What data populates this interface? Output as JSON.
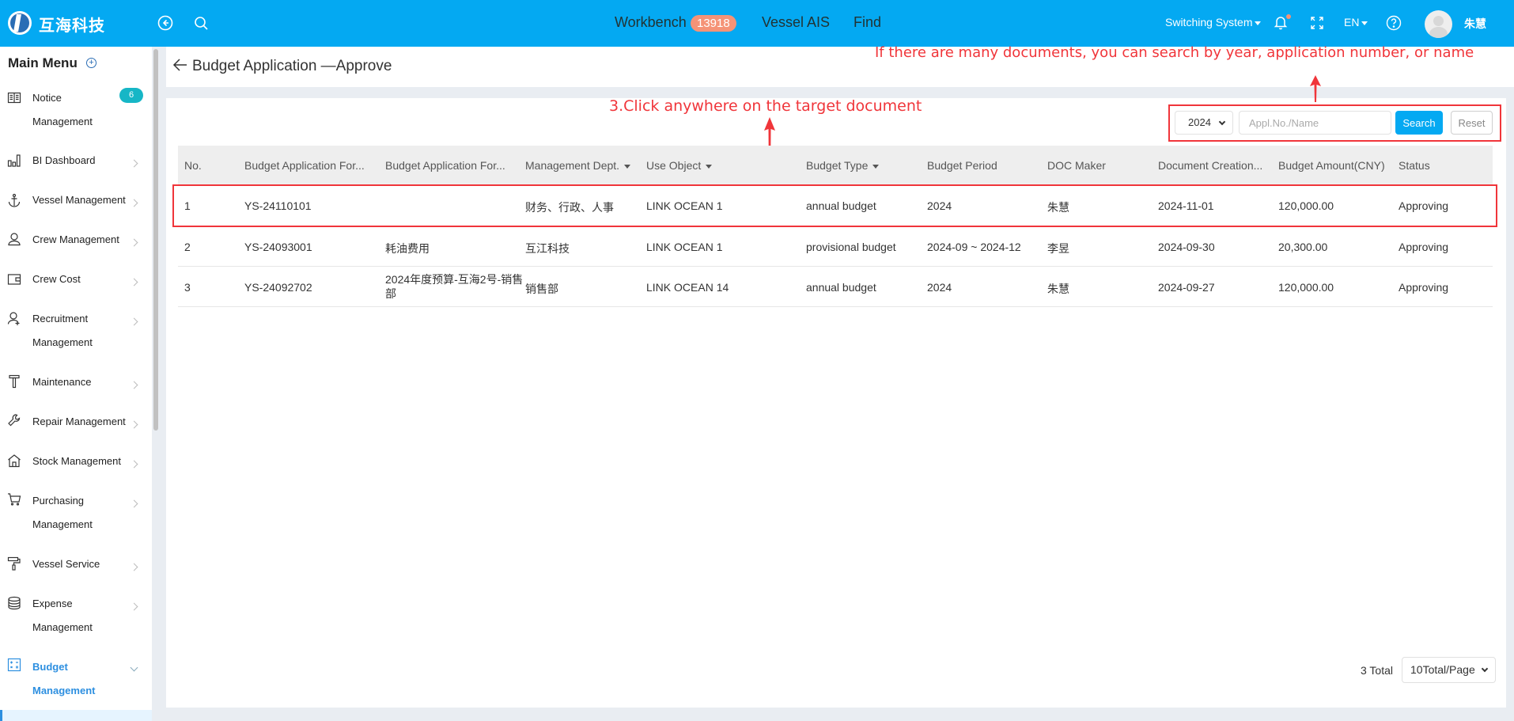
{
  "header": {
    "brand": "互海科技",
    "nav": {
      "workbench": "Workbench",
      "workbench_count": "13918",
      "vessel_ais": "Vessel AIS",
      "find": "Find"
    },
    "switching_system": "Switching System",
    "language": "EN",
    "username": "朱慧"
  },
  "sidebar": {
    "title": "Main Menu",
    "items": [
      {
        "label": "Notice Management",
        "icon": "book-icon",
        "badge": "6"
      },
      {
        "label": "BI Dashboard",
        "icon": "bar-chart-icon"
      },
      {
        "label": "Vessel Management",
        "icon": "anchor-icon"
      },
      {
        "label": "Crew Management",
        "icon": "person-icon"
      },
      {
        "label": "Crew Cost",
        "icon": "wallet-icon"
      },
      {
        "label": "Recruitment Management",
        "icon": "person-add-icon"
      },
      {
        "label": "Maintenance",
        "icon": "hammer-icon"
      },
      {
        "label": "Repair Management",
        "icon": "wrench-icon"
      },
      {
        "label": "Stock Management",
        "icon": "house-icon"
      },
      {
        "label": "Purchasing Management",
        "icon": "cart-icon"
      },
      {
        "label": "Vessel Service",
        "icon": "paint-roller-icon"
      },
      {
        "label": "Expense Management",
        "icon": "database-icon"
      },
      {
        "label": "Budget Management",
        "icon": "calculator-icon",
        "active": true
      }
    ]
  },
  "page": {
    "title": "Budget Application —Approve"
  },
  "annotations": {
    "search_hint": "If there are many documents, you can search by year, application number, or name",
    "click_hint": "3.Click anywhere on the target document"
  },
  "filters": {
    "year": "2024",
    "search_placeholder": "Appl.No./Name",
    "search_value": "",
    "search_label": "Search",
    "reset_label": "Reset"
  },
  "table": {
    "columns": [
      {
        "label": "No."
      },
      {
        "label": "Budget Application For..."
      },
      {
        "label": "Budget Application For..."
      },
      {
        "label": "Management Dept.",
        "sortable": true
      },
      {
        "label": "Use Object",
        "sortable": true
      },
      {
        "label": "Budget Type",
        "sortable": true
      },
      {
        "label": "Budget Period"
      },
      {
        "label": "DOC Maker"
      },
      {
        "label": "Document Creation..."
      },
      {
        "label": "Budget Amount(CNY)"
      },
      {
        "label": "Status"
      }
    ],
    "rows": [
      [
        "1",
        "YS-24110101",
        "",
        "财务、行政、人事",
        "LINK OCEAN 1",
        "annual budget",
        "2024",
        "朱慧",
        "2024-11-01",
        "120,000.00",
        "Approving"
      ],
      [
        "2",
        "YS-24093001",
        "耗油费用",
        "互江科技",
        "LINK OCEAN 1",
        "provisional budget",
        "2024-09 ~ 2024-12",
        "李昱",
        "2024-09-30",
        "20,300.00",
        "Approving"
      ],
      [
        "3",
        "YS-24092702",
        "2024年度预算-互海2号-销售部",
        "销售部",
        "LINK OCEAN 14",
        "annual budget",
        "2024",
        "朱慧",
        "2024-09-27",
        "120,000.00",
        "Approving"
      ]
    ]
  },
  "pagination": {
    "total": "3 Total",
    "page_size": "10Total/Page"
  },
  "colors": {
    "brand": "#04a9f2",
    "annotation": "#f0353a",
    "badge": "#f59377",
    "active_menu": "#2d8fe0"
  }
}
